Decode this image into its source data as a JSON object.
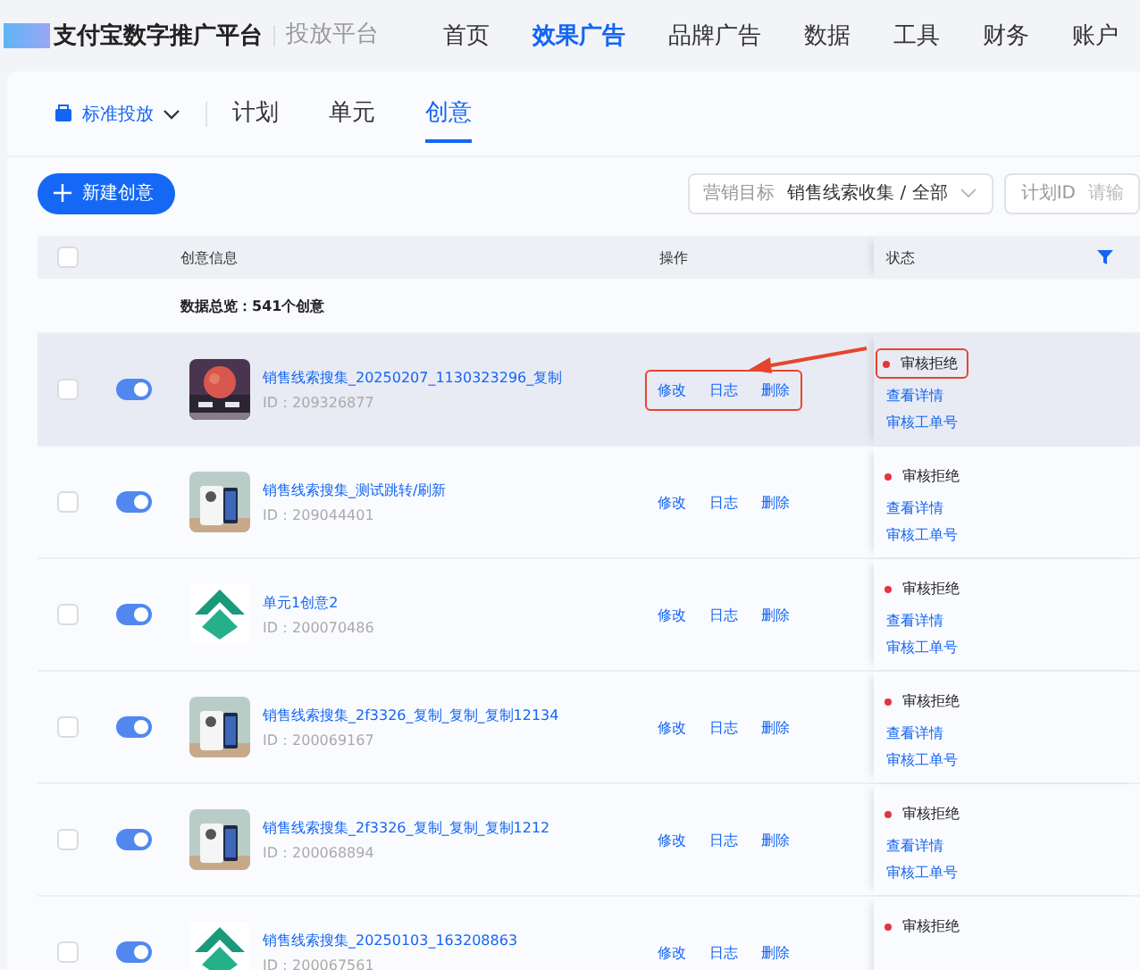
{
  "header": {
    "brand": "支付宝数字推广平台",
    "subtitle": "投放平台",
    "nav": [
      {
        "label": "首页",
        "selected": false
      },
      {
        "label": "效果广告",
        "selected": true
      },
      {
        "label": "品牌广告",
        "selected": false
      },
      {
        "label": "数据",
        "selected": false
      },
      {
        "label": "工具",
        "selected": false
      },
      {
        "label": "财务",
        "selected": false
      },
      {
        "label": "账户",
        "selected": false
      }
    ]
  },
  "subnav": {
    "mode": "标准投放",
    "tabs": [
      {
        "label": "计划",
        "selected": false
      },
      {
        "label": "单元",
        "selected": false
      },
      {
        "label": "创意",
        "selected": true
      }
    ]
  },
  "toolbar": {
    "new_button": "新建创意",
    "filters": [
      {
        "label": "营销目标",
        "value": "销售线索收集 / 全部"
      },
      {
        "label": "计划ID",
        "placeholder": "请输"
      }
    ]
  },
  "table": {
    "columns": [
      "创意信息",
      "操作",
      "状态"
    ],
    "header_checked": false,
    "summary": "数据总览：541个创意",
    "rows": [
      {
        "checked": false,
        "on": true,
        "highlighted": true,
        "annotated": true,
        "kind": "picture",
        "title": "销售线索搜集_20250207_1130323296_复制",
        "id": "ID：209326877",
        "actions": [
          "修改",
          "日志",
          "删除"
        ],
        "status": "审核拒绝",
        "links": [
          "查看详情",
          "审核工单号"
        ]
      },
      {
        "checked": false,
        "on": true,
        "highlighted": false,
        "annotated": false,
        "kind": "picture",
        "title": "销售线索搜集_测试跳转/刷新",
        "id": "ID：209044401",
        "actions": [
          "修改",
          "日志",
          "删除"
        ],
        "status": "审核拒绝",
        "links": [
          "查看详情",
          "审核工单号"
        ]
      },
      {
        "checked": false,
        "on": true,
        "highlighted": false,
        "annotated": false,
        "kind": "logo",
        "title": "单元1创意2",
        "id": "ID：200070486",
        "actions": [
          "修改",
          "日志",
          "删除"
        ],
        "status": "审核拒绝",
        "links": [
          "查看详情",
          "审核工单号"
        ]
      },
      {
        "checked": false,
        "on": true,
        "highlighted": false,
        "annotated": false,
        "kind": "picture",
        "title": "销售线索搜集_2f3326_复制_复制_复制12134",
        "id": "ID：200069167",
        "actions": [
          "修改",
          "日志",
          "删除"
        ],
        "status": "审核拒绝",
        "links": [
          "查看详情",
          "审核工单号"
        ]
      },
      {
        "checked": false,
        "on": true,
        "highlighted": false,
        "annotated": false,
        "kind": "picture",
        "title": "销售线索搜集_2f3326_复制_复制_复制1212",
        "id": "ID：200068894",
        "actions": [
          "修改",
          "日志",
          "删除"
        ],
        "status": "审核拒绝",
        "links": [
          "查看详情",
          "审核工单号"
        ]
      },
      {
        "checked": false,
        "on": true,
        "highlighted": false,
        "annotated": false,
        "kind": "logo",
        "title": "销售线索搜集_20250103_163208863",
        "id": "ID：200067561",
        "actions": [
          "修改",
          "日志",
          "删除"
        ],
        "status": "审核拒绝"
      }
    ]
  }
}
